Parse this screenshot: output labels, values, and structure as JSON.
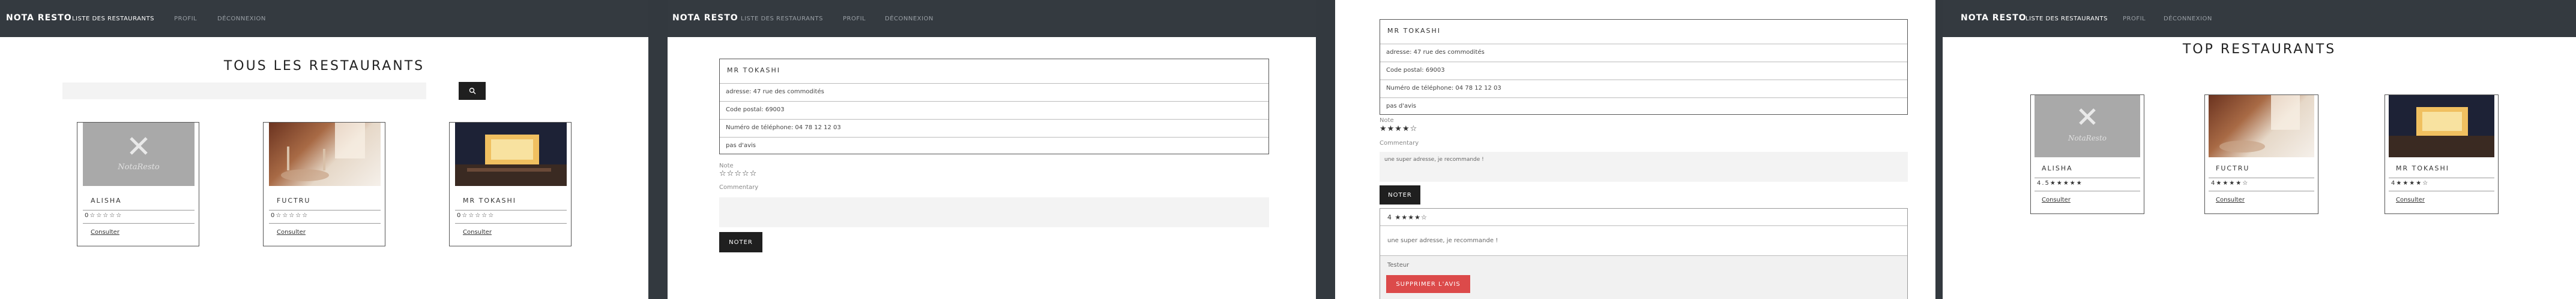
{
  "colors": {
    "navbar": "#343a40",
    "dark_button": "#1f1f1f",
    "danger_button": "#dc4a4a",
    "link_muted": "#9aa0a6"
  },
  "nav": {
    "brand": "NOTA RESTO",
    "list": "LISTE DES RESTAURANTS",
    "profile": "PROFIL",
    "logout": "DÉCONNEXION"
  },
  "list_page": {
    "title": "TOUS LES RESTAURANTS",
    "search_placeholder": "",
    "search_icon": "search-icon",
    "cards": [
      {
        "name": "ALISHA",
        "stars": "0☆☆☆☆☆",
        "rating": 0,
        "link": "Consulter",
        "image": "placeholder-logo"
      },
      {
        "name": "FUCTRU",
        "stars": "0☆☆☆☆☆",
        "rating": 0,
        "link": "Consulter",
        "image": "restaurant-photo"
      },
      {
        "name": "MR TOKASHI",
        "stars": "0☆☆☆☆☆",
        "rating": 0,
        "link": "Consulter",
        "image": "restaurant-photo"
      }
    ]
  },
  "detail_page": {
    "name": "MR TOKASHI",
    "address": "adresse: 47 rue des commodités",
    "postal": "Code postal: 69003",
    "phone": "Numéro de téléphone: 04 78 12 12 03",
    "no_review": "pas d'avis",
    "note_label": "Note",
    "note_stars": "☆☆☆☆☆",
    "comment_label": "Commentary",
    "comment_value": "",
    "submit": "NOTER"
  },
  "detail_page_scrolled": {
    "name": "MR TOKASHI",
    "address": "adresse: 47 rue des commodités",
    "postal": "Code postal: 69003",
    "phone": "Numéro de téléphone: 04 78 12 12 03",
    "no_review": "pas d'avis",
    "note_label": "Note",
    "note_stars": "★★★★☆",
    "rating": 4,
    "comment_label": "Commentary",
    "comment_value": "une super adresse, je recommande !",
    "submit": "NOTER",
    "review": {
      "stars": "4 ★★★★☆",
      "rating": 4,
      "text": "une super adresse, je recommande !",
      "author": "Testeur",
      "delete": "SUPPRIMER L'AVIS"
    }
  },
  "top_page": {
    "title": "TOP RESTAURANTS",
    "cards": [
      {
        "name": "ALISHA",
        "stars": "4.5★★★★★",
        "rating": 4.5,
        "link": "Consulter",
        "image": "placeholder-logo"
      },
      {
        "name": "FUCTRU",
        "stars": "4★★★★☆",
        "rating": 4,
        "link": "Consulter",
        "image": "restaurant-photo"
      },
      {
        "name": "MR TOKASHI",
        "stars": "4★★★★☆",
        "rating": 4,
        "link": "Consulter",
        "image": "restaurant-photo"
      }
    ]
  }
}
